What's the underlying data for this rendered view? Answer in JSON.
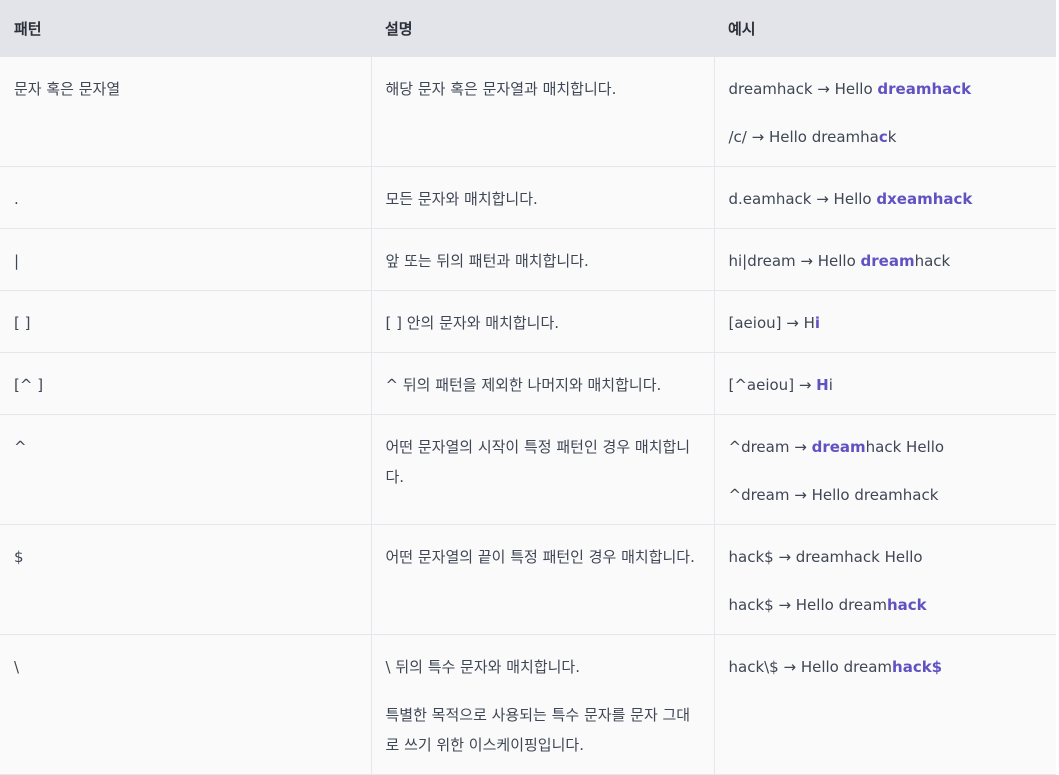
{
  "header": {
    "pattern": "패턴",
    "description": "설명",
    "example": "예시"
  },
  "rows": [
    {
      "pattern": "문자 혹은 문자열",
      "description": [
        "해당 문자 혹은 문자열과 매치합니다."
      ],
      "examples": [
        [
          {
            "t": "dreamhack → Hello ",
            "h": false
          },
          {
            "t": "dreamhack",
            "h": true
          }
        ],
        [
          {
            "t": "/c/ → Hello dreamha",
            "h": false
          },
          {
            "t": "c",
            "h": true
          },
          {
            "t": "k",
            "h": false
          }
        ]
      ]
    },
    {
      "pattern": ".",
      "description": [
        "모든 문자와 매치합니다."
      ],
      "examples": [
        [
          {
            "t": "d.eamhack → Hello ",
            "h": false
          },
          {
            "t": "dxeamhack",
            "h": true
          }
        ]
      ]
    },
    {
      "pattern": "|",
      "description": [
        "앞 또는 뒤의 패턴과 매치합니다."
      ],
      "examples": [
        [
          {
            "t": "hi|dream → Hello ",
            "h": false
          },
          {
            "t": "dream",
            "h": true
          },
          {
            "t": "hack",
            "h": false
          }
        ]
      ]
    },
    {
      "pattern": "[ ]",
      "description": [
        "[ ] 안의 문자와 매치합니다."
      ],
      "examples": [
        [
          {
            "t": "[aeiou] → H",
            "h": false
          },
          {
            "t": "i",
            "h": true
          }
        ]
      ]
    },
    {
      "pattern": "[^ ]",
      "description": [
        "^ 뒤의 패턴을 제외한 나머지와 매치합니다."
      ],
      "examples": [
        [
          {
            "t": "[^aeiou] → ",
            "h": false
          },
          {
            "t": "H",
            "h": true
          },
          {
            "t": "i",
            "h": false
          }
        ]
      ]
    },
    {
      "pattern": "^",
      "description": [
        "어떤 문자열의 시작이 특정 패턴인 경우 매치합니다."
      ],
      "examples": [
        [
          {
            "t": "^dream → ",
            "h": false
          },
          {
            "t": "dream",
            "h": true
          },
          {
            "t": "hack Hello",
            "h": false
          }
        ],
        [
          {
            "t": "^dream → Hello dreamhack",
            "h": false
          }
        ]
      ]
    },
    {
      "pattern": "$",
      "description": [
        "어떤 문자열의 끝이 특정 패턴인 경우 매치합니다."
      ],
      "examples": [
        [
          {
            "t": "hack$ → dreamhack Hello",
            "h": false
          }
        ],
        [
          {
            "t": "hack$ → Hello dream",
            "h": false
          },
          {
            "t": "hack",
            "h": true
          }
        ]
      ]
    },
    {
      "pattern": "\\",
      "description": [
        "\\ 뒤의 특수 문자와 매치합니다.",
        "특별한 목적으로 사용되는 특수 문자를 문자 그대로 쓰기 위한 이스케이핑입니다."
      ],
      "examples": [
        [
          {
            "t": "hack\\$ → Hello dream",
            "h": false
          },
          {
            "t": "hack$",
            "h": true
          }
        ]
      ]
    }
  ],
  "colors": {
    "highlight": "#6152c2",
    "header_bg": "#e3e4ea",
    "cell_bg": "#fafafb"
  }
}
